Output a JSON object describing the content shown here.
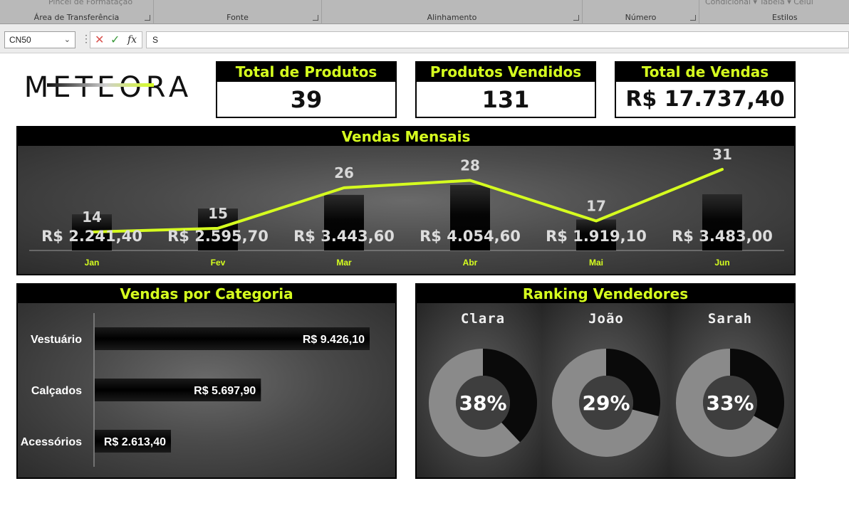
{
  "ribbon": {
    "groups": [
      {
        "label": "Área de Transferência",
        "faded": "Pincel de Formatação"
      },
      {
        "label": "Fonte"
      },
      {
        "label": "Alinhamento"
      },
      {
        "label": "Número"
      },
      {
        "label": "Estilos",
        "faded": "Condicional ▾     Tabela ▾     Célul"
      }
    ]
  },
  "formula_bar": {
    "name_box": "CN50",
    "content": "S",
    "fx": "fx"
  },
  "logo": {
    "text": "METEORA"
  },
  "kpis": [
    {
      "title": "Total de Produtos",
      "value": "39"
    },
    {
      "title": "Produtos Vendidos",
      "value": "131"
    },
    {
      "title": "Total de Vendas",
      "value": "R$  17.737,40"
    }
  ],
  "colors": {
    "accent": "#d6ff1f",
    "bar": "#000000",
    "donut_light": "#8a8a8a",
    "donut_dark": "#0a0a0a"
  },
  "chart_data": [
    {
      "type": "bar",
      "title": "Vendas Mensais",
      "categories": [
        "Jan",
        "Fev",
        "Mar",
        "Abr",
        "Mai",
        "Jun"
      ],
      "series": [
        {
          "values": [
            2241.4,
            2595.7,
            3443.6,
            4054.6,
            1919.1,
            3483.0
          ],
          "labels": [
            "R$ 2.241,40",
            "R$ 2.595,70",
            "R$ 3.443,60",
            "R$ 4.054,60",
            "R$ 1.919,10",
            "R$ 3.483,00"
          ]
        },
        {
          "type": "line",
          "values": [
            14,
            15,
            26,
            28,
            17,
            31
          ]
        }
      ]
    },
    {
      "type": "bar",
      "orientation": "horizontal",
      "title": "Vendas por Categoria",
      "categories": [
        "Vestuário",
        "Calçados",
        "Acessórios"
      ],
      "values": [
        9426.1,
        5697.9,
        2613.4
      ],
      "labels": [
        "R$ 9.426,10",
        "R$ 5.697,90",
        "R$ 2.613,40"
      ]
    },
    {
      "type": "pie",
      "title": "Ranking Vendedores",
      "donuts": [
        {
          "name": "Clara",
          "value": 38,
          "label": "38%"
        },
        {
          "name": "João",
          "value": 29,
          "label": "29%"
        },
        {
          "name": "Sarah",
          "value": 33,
          "label": "33%"
        }
      ]
    }
  ]
}
